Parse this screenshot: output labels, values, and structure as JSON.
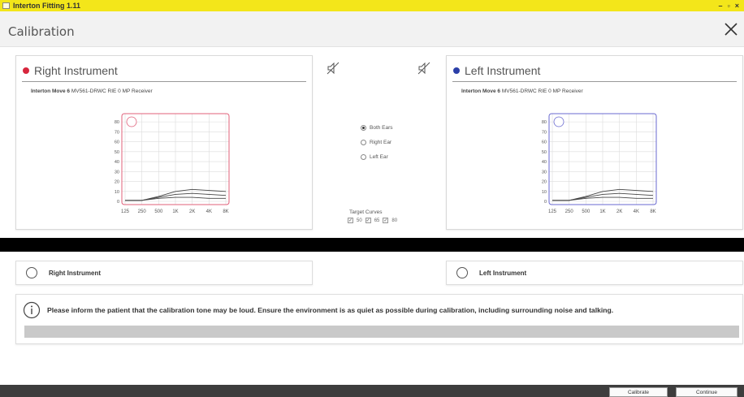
{
  "window": {
    "title": "Interton Fitting 1.11",
    "controls": [
      "–",
      "▫",
      "×"
    ]
  },
  "page": {
    "title": "Calibration",
    "close_icon": "close-icon"
  },
  "right_instrument": {
    "title": "Right Instrument",
    "color": "#d7263d",
    "model_bold": "Interton Move 6",
    "model_rest": "MV561-DRWC RIE 0 MP Receiver",
    "chart_data": {
      "type": "line",
      "x_ticks": [
        "125",
        "250",
        "500",
        "1K",
        "2K",
        "4K",
        "8K"
      ],
      "y_ticks": [
        "80",
        "70",
        "60",
        "50",
        "40",
        "30",
        "20",
        "10",
        "0"
      ],
      "ylim": [
        0,
        85
      ],
      "frame_color": "#e0607a",
      "series": [
        {
          "values": [
            1,
            1,
            5,
            10,
            12,
            11,
            10
          ]
        },
        {
          "values": [
            1,
            1,
            4,
            7,
            8,
            7,
            6
          ]
        },
        {
          "values": [
            1,
            1,
            3,
            4,
            4,
            3,
            3
          ]
        }
      ]
    }
  },
  "left_instrument": {
    "title": "Left Instrument",
    "color": "#2b3fa8",
    "model_bold": "Interton Move 6",
    "model_rest": "MV561-DRWC RIE 0 MP Receiver",
    "chart_data": {
      "type": "line",
      "x_ticks": [
        "125",
        "250",
        "500",
        "1K",
        "2K",
        "4K",
        "8K"
      ],
      "y_ticks": [
        "80",
        "70",
        "60",
        "50",
        "40",
        "30",
        "20",
        "10",
        "0"
      ],
      "ylim": [
        0,
        85
      ],
      "frame_color": "#6a6ad0",
      "series": [
        {
          "values": [
            1,
            1,
            5,
            10,
            12,
            11,
            10
          ]
        },
        {
          "values": [
            1,
            1,
            4,
            7,
            8,
            7,
            6
          ]
        },
        {
          "values": [
            1,
            1,
            3,
            4,
            4,
            3,
            3
          ]
        }
      ]
    }
  },
  "center": {
    "speaker_left_icon": "speaker-muted-icon",
    "speaker_right_icon": "speaker-muted-icon",
    "ear_options": [
      {
        "label": "Both Ears",
        "selected": true
      },
      {
        "label": "Right Ear",
        "selected": false
      },
      {
        "label": "Left Ear",
        "selected": false
      }
    ],
    "target_curves_label": "Target Curves",
    "target_curves": [
      "50",
      "65",
      "80"
    ]
  },
  "selectors": {
    "right": "Right Instrument",
    "left": "Left Instrument"
  },
  "info": {
    "message": "Please inform the patient that the calibration tone may be loud.  Ensure the environment is as quiet as possible during calibration, including surrounding noise and talking."
  },
  "footer": {
    "calibrate": "Calibrate",
    "continue": "Continue"
  }
}
